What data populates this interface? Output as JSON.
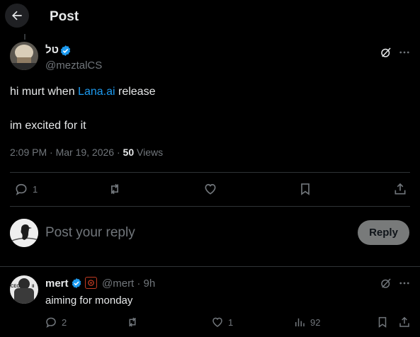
{
  "header": {
    "title": "Post"
  },
  "post": {
    "author_name": "טל",
    "author_handle": "@meztalCS",
    "text_prefix": "hi murt when ",
    "link_text": "Lana.ai",
    "text_suffix": " release",
    "text_line2": "im excited for it",
    "timestamp": "2:09 PM · Mar 19, 2026 · ",
    "views_count": "50",
    "views_label": " Views",
    "actions": {
      "replies": "1",
      "reposts": "",
      "likes": "",
      "bookmarks": ""
    }
  },
  "composer": {
    "placeholder": "Post your reply",
    "reply_label": "Reply"
  },
  "reply": {
    "author_name": "mert",
    "handle_time": "@mert · 9h",
    "text": "aiming for monday",
    "actions": {
      "replies": "2",
      "reposts": "",
      "likes": "1",
      "views": "92"
    }
  },
  "icons": {
    "back": "arrow-left-icon",
    "verified": "verified-badge-icon",
    "grok": "grok-icon",
    "more": "more-icon",
    "reply": "reply-icon",
    "repost": "repost-icon",
    "like": "like-icon",
    "bookmark": "bookmark-icon",
    "share": "share-icon",
    "views": "views-icon"
  },
  "colors": {
    "background": "#000000",
    "text": "#e7e9ea",
    "muted": "#71767b",
    "link": "#1d9bf0",
    "verified": "#1d9bf0",
    "divider": "#2f3336"
  }
}
